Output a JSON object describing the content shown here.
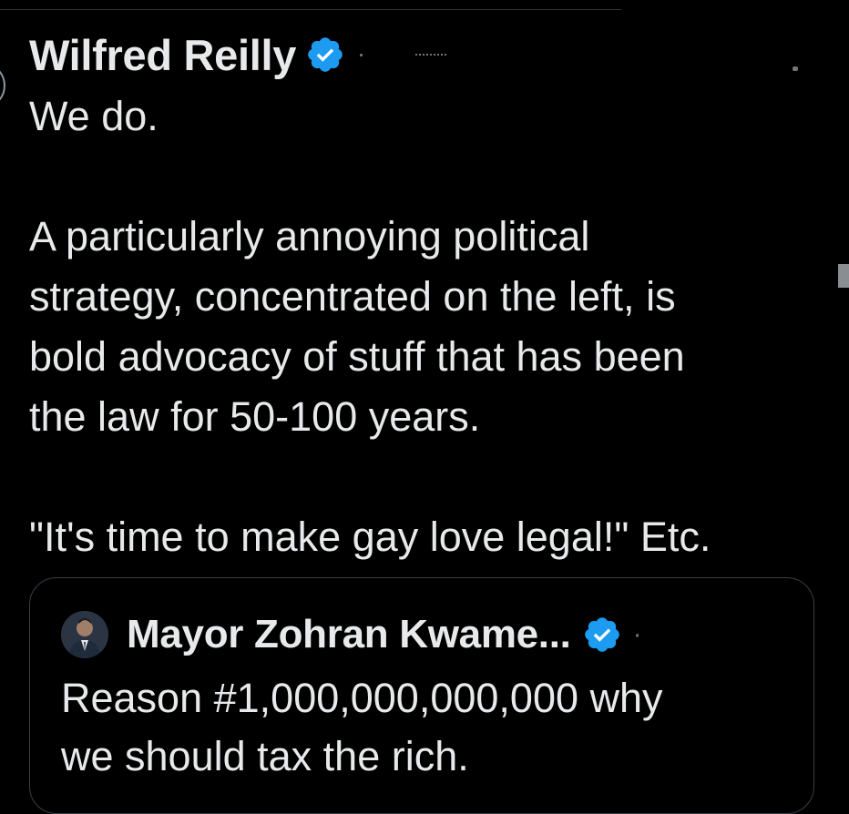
{
  "tweet": {
    "author_name": "Wilfred Reilly",
    "body": "We do.\n\nA particularly annoying political\nstrategy, concentrated on the left, is\nbold advocacy of stuff that has been\nthe law for 50-100 years.\n\n\"It's time to make gay love legal!\" Etc."
  },
  "quoted_tweet": {
    "author_name": "Mayor Zohran Kwame...",
    "separator": "·",
    "body": "Reason #1,000,000,000,000 why\nwe should tax the rich."
  },
  "colors": {
    "background": "#000000",
    "text": "#e7e9ea",
    "verified_blue": "#1d9bf0",
    "muted": "#71767b",
    "border": "#2f3336"
  },
  "icons": {
    "verified": "verified-badge-icon",
    "avatar": "avatar"
  }
}
